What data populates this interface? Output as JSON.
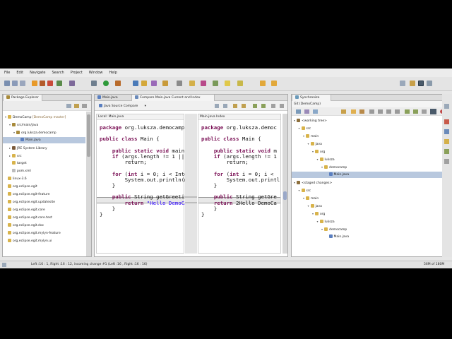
{
  "menu": [
    "File",
    "Edit",
    "Navigate",
    "Search",
    "Project",
    "Window",
    "Help"
  ],
  "package_explorer": {
    "tab_label": "Package Explorer",
    "items": [
      {
        "label": "DemoCamp",
        "suffix": " [DemoCamp master]",
        "indent": 0,
        "icon": "project-icon",
        "twisty": "▾"
      },
      {
        "label": "src/main/java",
        "indent": 1,
        "icon": "source-folder-icon",
        "twisty": "▾"
      },
      {
        "label": "org.luksza.democamp",
        "indent": 2,
        "icon": "package-icon",
        "twisty": "▾"
      },
      {
        "label": "Main.java",
        "indent": 3,
        "icon": "java-file-icon",
        "twisty": "",
        "selected": true
      },
      {
        "label": "JRE System Library",
        "indent": 1,
        "icon": "library-icon",
        "twisty": "▸"
      },
      {
        "label": "src",
        "indent": 1,
        "icon": "folder-icon",
        "twisty": "▸"
      },
      {
        "label": "target",
        "indent": 1,
        "icon": "folder-icon",
        "twisty": ""
      },
      {
        "label": "pom.xml",
        "indent": 1,
        "icon": "xml-file-icon",
        "twisty": ""
      },
      {
        "label": "linux-3.6",
        "indent": 0,
        "icon": "project-icon",
        "twisty": ""
      },
      {
        "label": "org.eclipse.egit",
        "indent": 0,
        "icon": "project-icon",
        "twisty": ""
      },
      {
        "label": "org.eclipse.egit-feature",
        "indent": 0,
        "icon": "project-icon",
        "twisty": ""
      },
      {
        "label": "org.eclipse.egit.updatesite",
        "indent": 0,
        "icon": "project-icon",
        "twisty": ""
      },
      {
        "label": "org.eclipse.egit.core",
        "indent": 0,
        "icon": "project-icon",
        "twisty": ""
      },
      {
        "label": "org.eclipse.egit.core.test",
        "indent": 0,
        "icon": "project-icon",
        "twisty": ""
      },
      {
        "label": "org.eclipse.egit.doc",
        "indent": 0,
        "icon": "project-icon",
        "twisty": ""
      },
      {
        "label": "org.eclipse.egit.mylyn-feature",
        "indent": 0,
        "icon": "project-icon",
        "twisty": ""
      },
      {
        "label": "org.eclipse.egit.mylyn.ui",
        "indent": 0,
        "icon": "project-icon",
        "twisty": ""
      }
    ]
  },
  "editor": {
    "tab_main": "Main.java",
    "tab_compare": "Compare Main.java Current and Index",
    "compare_toolbar_label": "Java Source Compare",
    "left_header": "Local: Main.java",
    "right_header": "Main.java Index",
    "left_lines": [
      "package org.luksza.democamp;",
      "",
      "public class Main {",
      "",
      "    public static void main(",
      "    if (args.length != 1 || ",
      "        return;",
      "",
      "    for (int i = 0; i < Inte",
      "        System.out.println(m",
      "    }",
      "",
      "    public String getGreetin",
      "        return \"Hello DemoCa",
      "    }",
      "}"
    ],
    "right_lines": [
      "package org.luksza.democ",
      "",
      "public class Main {",
      "",
      "    public static void m",
      "    if (args.length != 1",
      "        return;",
      "",
      "    for (int i = 0; i < ",
      "        System.out.printl",
      "    }",
      "",
      "    public String getGre",
      "    return 2Hello DemoCa",
      "    }",
      "}"
    ]
  },
  "synchronize": {
    "tab_label": "Synchronize",
    "repo_label": "Git (DemoCamp)",
    "items": [
      {
        "label": "<working tree>",
        "indent": 0,
        "icon": "working-tree-icon",
        "twisty": "▾"
      },
      {
        "label": "src",
        "indent": 1,
        "icon": "folder-icon",
        "twisty": "▾"
      },
      {
        "label": "main",
        "indent": 2,
        "icon": "folder-icon",
        "twisty": "▾"
      },
      {
        "label": "java",
        "indent": 3,
        "icon": "folder-icon",
        "twisty": "▾"
      },
      {
        "label": "org",
        "indent": 4,
        "icon": "folder-icon",
        "twisty": "▾"
      },
      {
        "label": "luksza",
        "indent": 5,
        "icon": "folder-icon",
        "twisty": "▾"
      },
      {
        "label": "democamp",
        "indent": 6,
        "icon": "folder-icon",
        "twisty": "▾"
      },
      {
        "label": "Main.java",
        "indent": 7,
        "icon": "java-file-icon",
        "twisty": "",
        "selected": true
      },
      {
        "label": "<staged changes>",
        "indent": 0,
        "icon": "staged-icon",
        "twisty": "▾"
      },
      {
        "label": "src",
        "indent": 1,
        "icon": "folder-icon",
        "twisty": "▾"
      },
      {
        "label": "main",
        "indent": 2,
        "icon": "folder-icon",
        "twisty": "▾"
      },
      {
        "label": "java",
        "indent": 3,
        "icon": "folder-icon",
        "twisty": "▾"
      },
      {
        "label": "org",
        "indent": 4,
        "icon": "folder-icon",
        "twisty": "▾"
      },
      {
        "label": "luksza",
        "indent": 5,
        "icon": "folder-icon",
        "twisty": "▾"
      },
      {
        "label": "democamp",
        "indent": 6,
        "icon": "folder-icon",
        "twisty": "▾"
      },
      {
        "label": "Main.java",
        "indent": 7,
        "icon": "java-file-icon",
        "twisty": ""
      }
    ]
  },
  "status": {
    "left": "Left :16 : 1, Right :16 : 12, incoming change #1 (Left :16 , Right :16 : 16)",
    "right": "56M of 180M"
  },
  "colors": {
    "selection": "#b8c8de",
    "keyword": "#7a1055",
    "string": "#2a00ff"
  }
}
